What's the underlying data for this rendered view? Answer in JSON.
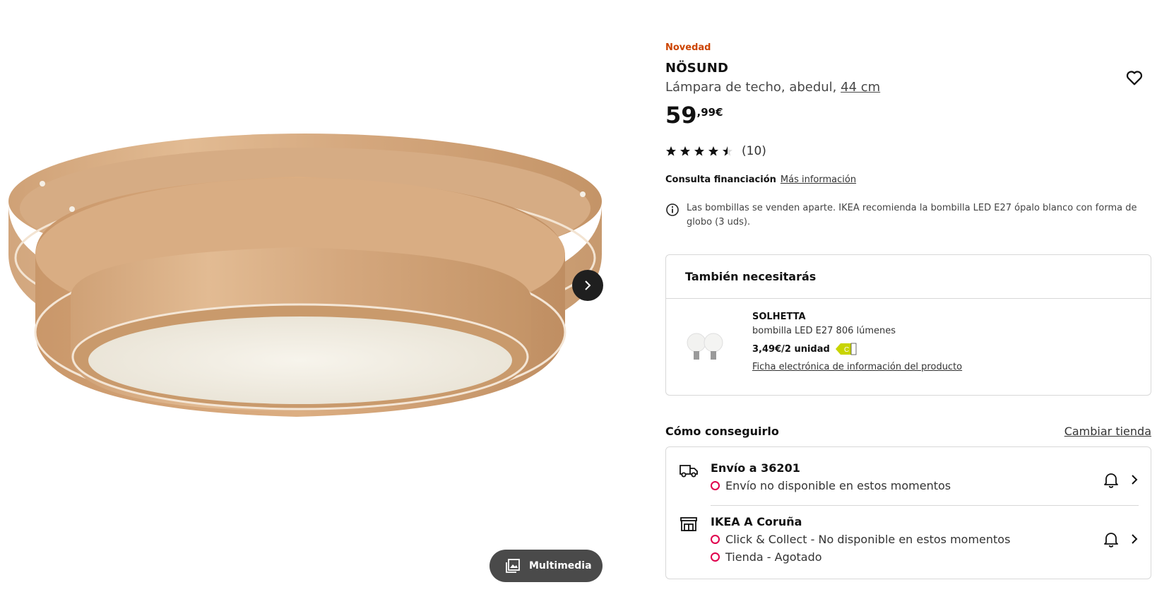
{
  "gallery": {
    "image_alt": "Lámpara de techo NÖSUND de abedul",
    "next_icon": "chevron-right-icon",
    "multimedia_label": "Multimedia",
    "multimedia_icon": "image-gallery-icon"
  },
  "product": {
    "badge": "Novedad",
    "name": "NÖSUND",
    "description": "Lámpara de techo, abedul, ",
    "size": "44 cm",
    "price_integer": "59",
    "price_decimals": ",99€",
    "rating": {
      "stars": 4.5,
      "max": 5,
      "count_label": "(10)"
    },
    "favorite_icon": "heart-icon"
  },
  "financing": {
    "label": "Consulta financiación",
    "link": "Más información"
  },
  "bulb_note": {
    "icon": "info-icon",
    "text": "Las bombillas se venden aparte. IKEA recomienda la bombilla LED E27 ópalo blanco con forma de globo (3 uds)."
  },
  "accessories": {
    "title": "También necesitarás",
    "item": {
      "name": "SOLHETTA",
      "description": "bombilla LED E27 806 lúmenes",
      "price": "3,49€/2 unidad",
      "energy_class": "C",
      "sheet_link": "Ficha electrónica de información del producto"
    }
  },
  "how_to_get": {
    "title": "Cómo conseguirlo",
    "change_store": "Cambiar tienda",
    "delivery": {
      "icon": "truck-icon",
      "title": "Envío a 36201",
      "statuses": [
        "Envío no disponible en estos momentos"
      ]
    },
    "store": {
      "icon": "store-icon",
      "title": "IKEA A Coruña",
      "statuses": [
        "Click & Collect - No disponible en estos momentos",
        "Tienda - Agotado"
      ]
    },
    "colors": {
      "unavailable": "#e0004d"
    }
  }
}
